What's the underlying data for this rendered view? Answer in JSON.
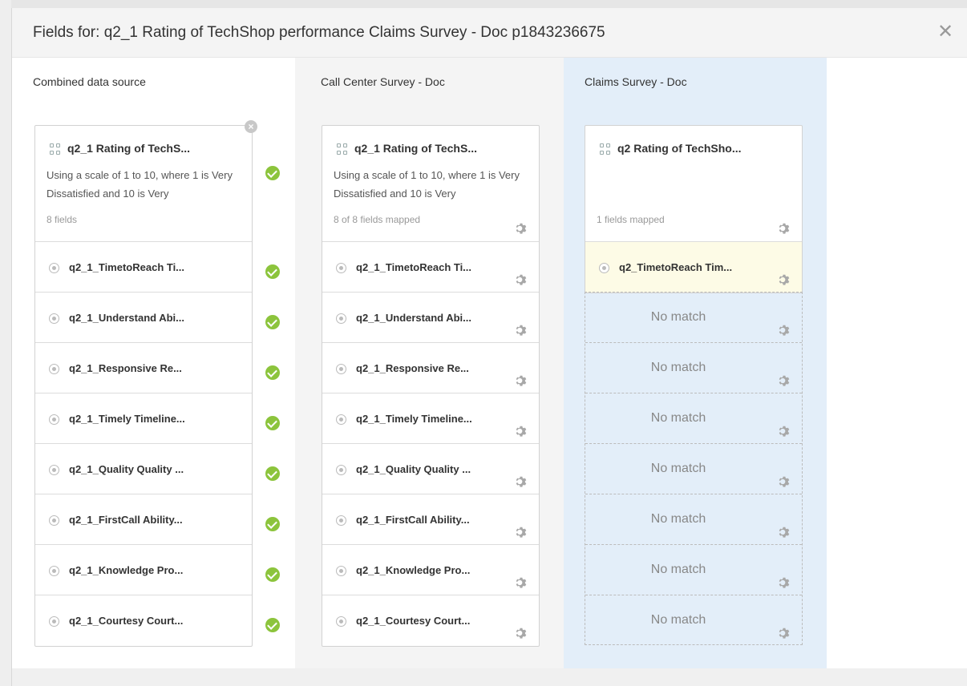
{
  "dialog": {
    "title": "Fields for: q2_1 Rating of TechShop performance Claims Survey - Doc p1843236675",
    "close_symbol": "✕"
  },
  "columns": [
    {
      "header": "Combined data source",
      "group": {
        "title": "q2_1 Rating of TechS...",
        "description": "Using a scale of 1 to 10, where 1 is Very Dissatisfied and 10 is Very",
        "count": "8 fields"
      },
      "fields": [
        "q2_1_TimetoReach Ti...",
        "q2_1_Understand Abi...",
        "q2_1_Responsive Re...",
        "q2_1_Timely Timeline...",
        "q2_1_Quality Quality ...",
        "q2_1_FirstCall Ability...",
        "q2_1_Knowledge Pro...",
        "q2_1_Courtesy Court..."
      ]
    },
    {
      "header": "Call Center Survey - Doc",
      "group": {
        "title": "q2_1 Rating of TechS...",
        "description": "Using a scale of 1 to 10, where 1 is Very Dissatisfied and 10 is Very",
        "count": "8 of 8 fields mapped"
      },
      "fields": [
        "q2_1_TimetoReach Ti...",
        "q2_1_Understand Abi...",
        "q2_1_Responsive Re...",
        "q2_1_Timely Timeline...",
        "q2_1_Quality Quality ...",
        "q2_1_FirstCall Ability...",
        "q2_1_Knowledge Pro...",
        "q2_1_Courtesy Court..."
      ]
    },
    {
      "header": "Claims Survey - Doc",
      "group": {
        "title": "q2 Rating of TechSho...",
        "description": "",
        "count": "1 fields mapped"
      },
      "fields": [
        "q2_TimetoReach Tim..."
      ],
      "no_match": [
        "No match",
        "No match",
        "No match",
        "No match",
        "No match",
        "No match",
        "No match"
      ]
    }
  ],
  "icons": {
    "status_ok": "check-circle-icon",
    "settings": "gear-icon",
    "remove": "remove-icon",
    "field": "radio-icon",
    "group": "grid-icon"
  },
  "colors": {
    "check_green": "#8cc43c",
    "selected_column_bg": "#e3eef9",
    "highlight_row_bg": "#fdfbe6"
  }
}
